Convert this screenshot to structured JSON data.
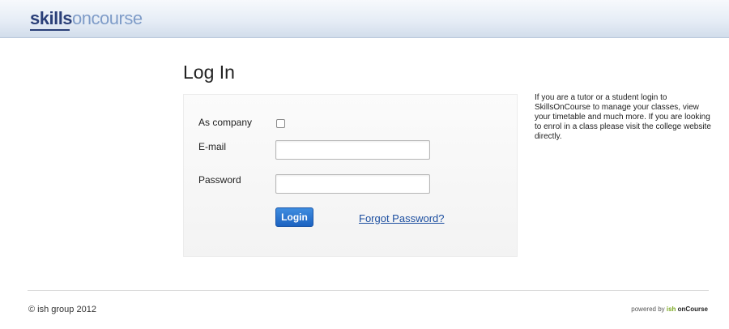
{
  "header": {
    "logo_part1": "skills",
    "logo_part2": "oncourse"
  },
  "page_title": "Log In",
  "form": {
    "company_label": "As company",
    "company_checked": false,
    "email_label": "E-mail",
    "email_value": "",
    "password_label": "Password",
    "password_value": "",
    "login_button": "Login",
    "forgot_link": "Forgot Password?"
  },
  "info_text": "If you are a tutor or a student login to SkillsOnCourse to manage your classes, view your timetable and much more. If you are looking to enrol in a class please visit the college website directly.",
  "footer": {
    "copyright": "© ish group 2012",
    "powered_prefix": "powered by ",
    "powered_ish": "ish",
    "powered_oncourse": " onCourse"
  },
  "colors": {
    "accent": "#1c62c0",
    "link": "#1d4fa0",
    "logo_dark": "#2a3f78",
    "logo_light": "#7f9cc8"
  }
}
